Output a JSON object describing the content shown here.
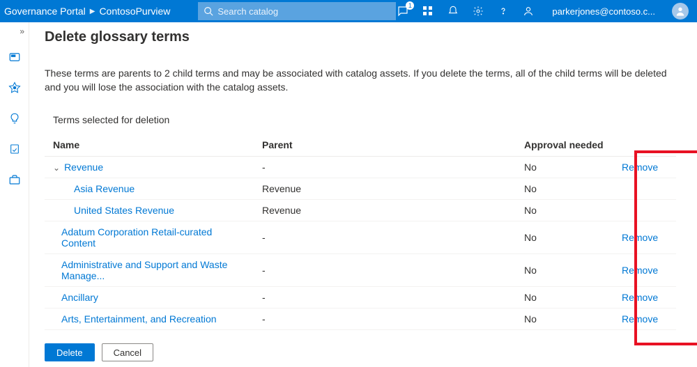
{
  "header": {
    "breadcrumb": [
      "Governance Portal",
      "ContosoPurview"
    ],
    "search_placeholder": "Search catalog",
    "user_email": "parkerjones@contoso.c...",
    "chat_badge": "1"
  },
  "page": {
    "title": "Delete glossary terms",
    "description": "These terms are parents to 2 child terms and may be associated with catalog assets. If you delete the terms, all of the child terms will be deleted and you will lose the association with the catalog assets.",
    "section_label": "Terms selected for deletion"
  },
  "table": {
    "columns": {
      "name": "Name",
      "parent": "Parent",
      "approval": "Approval needed",
      "action": ""
    },
    "rows": [
      {
        "name": "Revenue",
        "parent": "-",
        "approval": "No",
        "action": "Remove",
        "indent": 0,
        "expanded": true
      },
      {
        "name": "Asia Revenue",
        "parent": "Revenue",
        "approval": "No",
        "action": "",
        "indent": 1
      },
      {
        "name": "United States Revenue",
        "parent": "Revenue",
        "approval": "No",
        "action": "",
        "indent": 1
      },
      {
        "name": "Adatum Corporation Retail-curated Content",
        "parent": "-",
        "approval": "No",
        "action": "Remove",
        "indent": 0
      },
      {
        "name": "Administrative and Support and Waste Manage...",
        "parent": "-",
        "approval": "No",
        "action": "Remove",
        "indent": 0
      },
      {
        "name": "Ancillary",
        "parent": "-",
        "approval": "No",
        "action": "Remove",
        "indent": 0
      },
      {
        "name": "Arts, Entertainment, and Recreation",
        "parent": "-",
        "approval": "No",
        "action": "Remove",
        "indent": 0
      }
    ]
  },
  "footer": {
    "delete": "Delete",
    "cancel": "Cancel"
  }
}
